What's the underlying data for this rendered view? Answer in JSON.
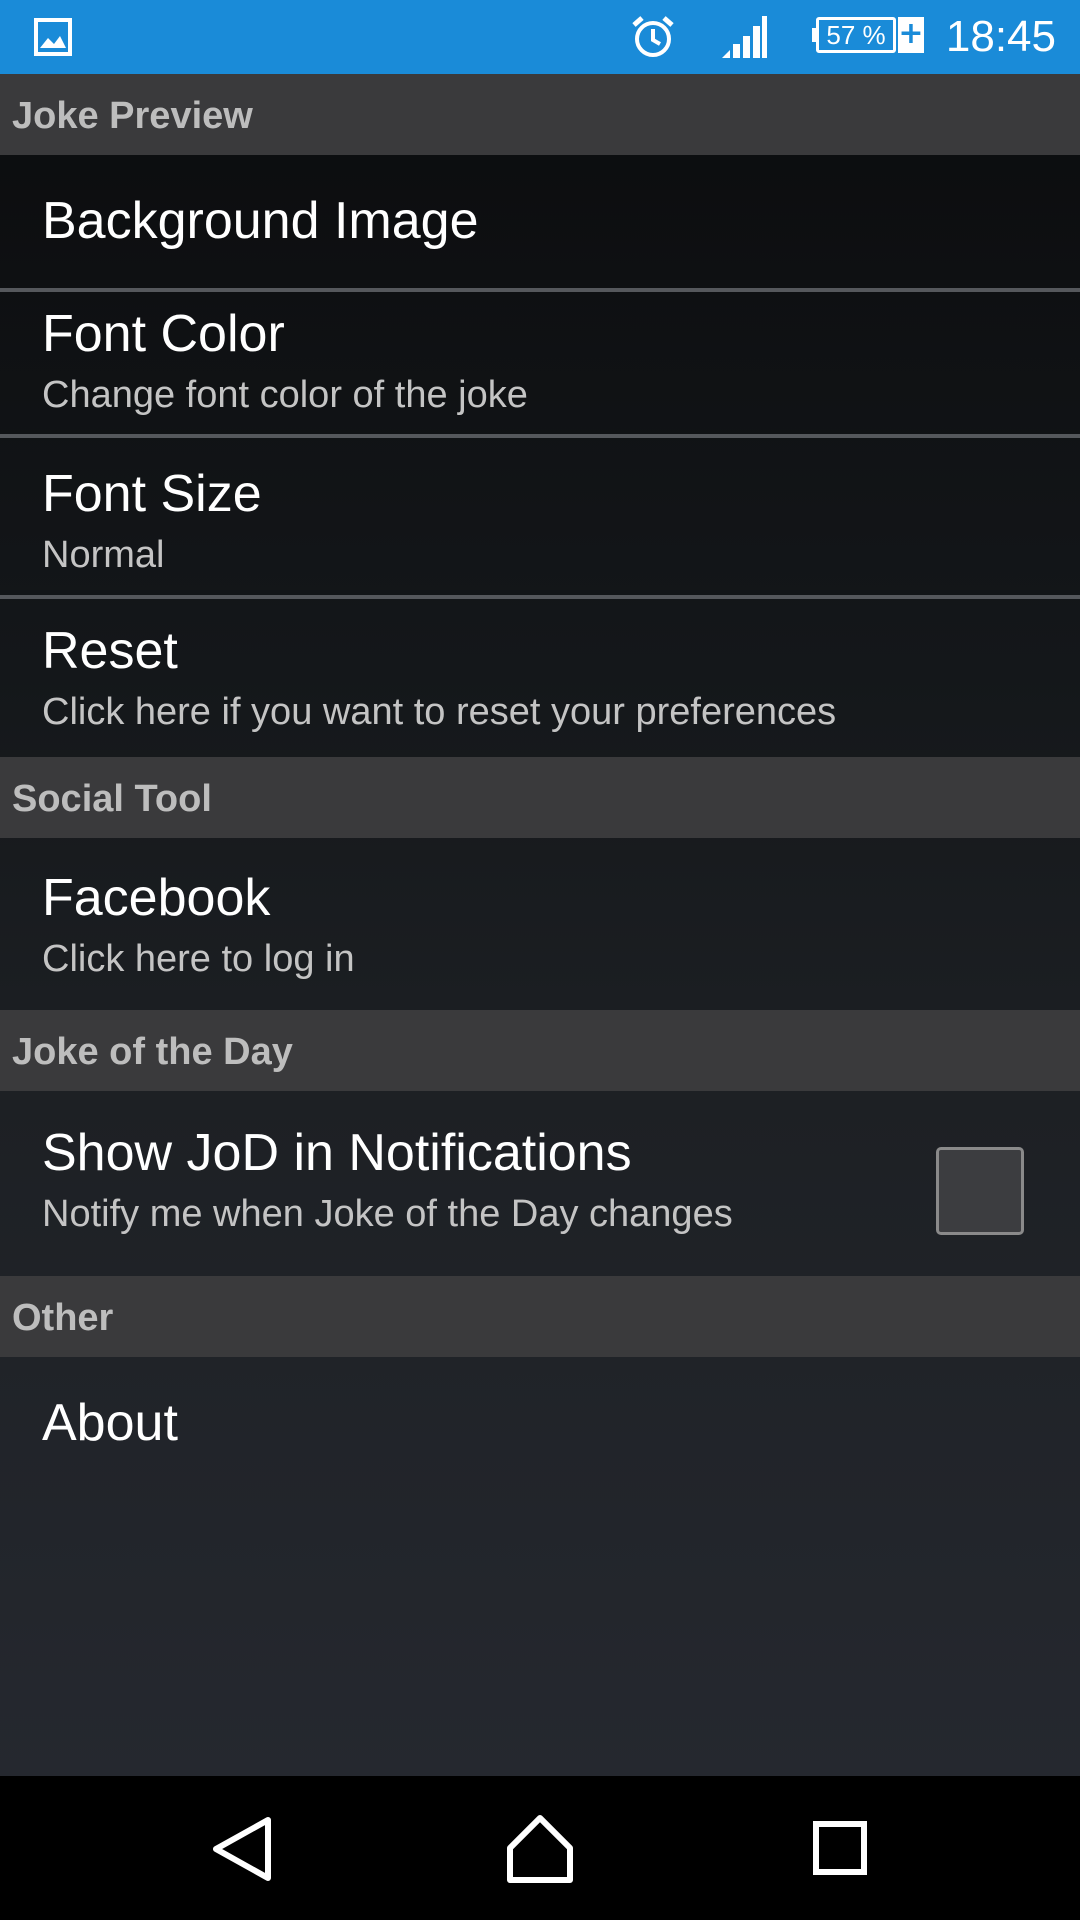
{
  "status_bar": {
    "time": "18:45",
    "battery_level": "57 %",
    "charging": true,
    "icons": [
      "gallery-icon",
      "alarm-icon",
      "signal-icon",
      "battery-icon"
    ],
    "background_color": "#1a8bd8"
  },
  "sections": {
    "joke_preview": {
      "header": "Joke Preview",
      "background_image": {
        "title": "Background Image"
      },
      "font_color": {
        "title": "Font Color",
        "summary": "Change font color of the joke"
      },
      "font_size": {
        "title": "Font Size",
        "summary": "Normal"
      },
      "reset": {
        "title": "Reset",
        "summary": "Click here if you want to reset your preferences"
      }
    },
    "social_tool": {
      "header": "Social Tool",
      "facebook": {
        "title": "Facebook",
        "summary": "Click here to log in"
      }
    },
    "joke_of_the_day": {
      "header": "Joke of the Day",
      "show_jod": {
        "title": "Show JoD in Notifications",
        "summary": "Notify me when Joke of the Day changes",
        "checked": false
      }
    },
    "other": {
      "header": "Other",
      "about": {
        "title": "About"
      }
    }
  },
  "nav_bar": {
    "icons": [
      "back-icon",
      "home-icon",
      "recents-icon"
    ]
  },
  "colors": {
    "section_header_bg": "#3a3a3c",
    "section_header_text": "#bdbdbd",
    "title_text": "#ffffff",
    "summary_text": "#c4c4c4"
  }
}
